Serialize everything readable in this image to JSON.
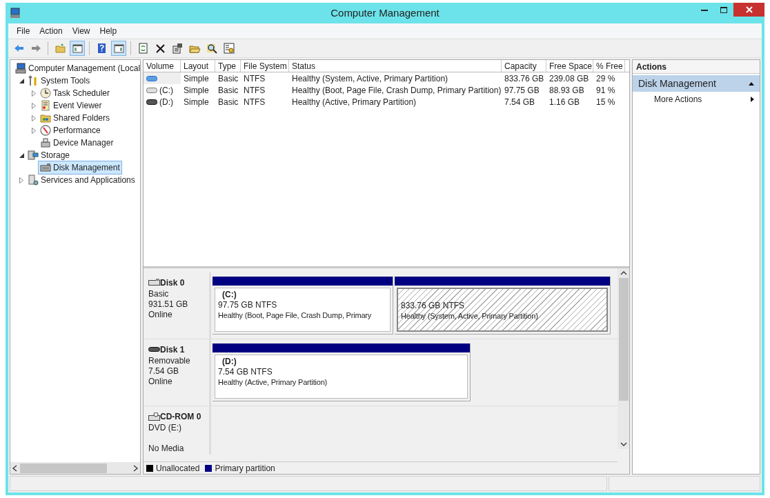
{
  "window": {
    "title": "Computer Management"
  },
  "menu": [
    "File",
    "Action",
    "View",
    "Help"
  ],
  "toolbar": [
    {
      "kind": "back",
      "selected": false
    },
    {
      "kind": "forward",
      "selected": false
    },
    {
      "kind": "sep"
    },
    {
      "kind": "folder-up",
      "selected": false
    },
    {
      "kind": "console-tree",
      "selected": true
    },
    {
      "kind": "sep"
    },
    {
      "kind": "help",
      "selected": false
    },
    {
      "kind": "action-pane",
      "selected": true
    },
    {
      "kind": "sep"
    },
    {
      "kind": "refresh",
      "selected": false
    },
    {
      "kind": "delete",
      "selected": false
    },
    {
      "kind": "properties",
      "selected": false
    },
    {
      "kind": "open",
      "selected": false
    },
    {
      "kind": "search",
      "selected": false
    },
    {
      "kind": "settings",
      "selected": false
    }
  ],
  "tree": [
    {
      "label": "Computer Management (Local",
      "kind": "computer",
      "selected": false,
      "children": [
        {
          "label": "System Tools",
          "kind": "tools",
          "expanded": true,
          "selected": false,
          "children": [
            {
              "label": "Task Scheduler",
              "kind": "clock",
              "expanded": false,
              "selected": false
            },
            {
              "label": "Event Viewer",
              "kind": "log",
              "expanded": false,
              "selected": false
            },
            {
              "label": "Shared Folders",
              "kind": "share",
              "expanded": false,
              "selected": false
            },
            {
              "label": "Performance",
              "kind": "gauge",
              "expanded": false,
              "selected": false
            },
            {
              "label": "Device Manager",
              "kind": "device",
              "selected": false
            }
          ]
        },
        {
          "label": "Storage",
          "kind": "storage",
          "expanded": true,
          "selected": false,
          "children": [
            {
              "label": "Disk Management",
              "kind": "disk",
              "selected": true
            }
          ]
        },
        {
          "label": "Services and Applications",
          "kind": "services",
          "expanded": false,
          "selected": false
        }
      ]
    }
  ],
  "table": {
    "columns": [
      "Volume",
      "Layout",
      "Type",
      "File System",
      "Status",
      "Capacity",
      "Free Space",
      "% Free"
    ],
    "rows": [
      {
        "kind": "blue",
        "cells": [
          "",
          "Simple",
          "Basic",
          "NTFS",
          "Healthy (System, Active, Primary Partition)",
          "833.76 GB",
          "239.08 GB",
          "29 %"
        ]
      },
      {
        "kind": "gray",
        "cells": [
          "(C:)",
          "Simple",
          "Basic",
          "NTFS",
          "Healthy (Boot, Page File, Crash Dump, Primary Partition)",
          "97.75 GB",
          "88.93 GB",
          "91 %"
        ]
      },
      {
        "kind": "dark",
        "cells": [
          "(D:)",
          "Simple",
          "Basic",
          "NTFS",
          "Healthy (Active, Primary Partition)",
          "7.54 GB",
          "1.16 GB",
          "15 %"
        ]
      }
    ]
  },
  "disks": [
    {
      "name": "Disk 0",
      "kind": "hdd",
      "info": [
        "Basic",
        "931.51 GB",
        "Online"
      ],
      "partitions": [
        {
          "name": "(C:)",
          "size": "97.75 GB NTFS",
          "status": "Healthy (Boot, Page File, Crash Dump, Primary",
          "selected": false
        },
        {
          "size": "833.76 GB NTFS",
          "status": "Healthy (System, Active, Primary Partition)",
          "selected": true
        }
      ]
    },
    {
      "name": "Disk 1",
      "kind": "removable",
      "info": [
        "Removable",
        "7.54 GB",
        "Online"
      ],
      "partitions": [
        {
          "name": "(D:)",
          "size": "7.54 GB NTFS",
          "status": "Healthy (Active, Primary Partition)",
          "selected": false
        }
      ]
    },
    {
      "name": "CD-ROM 0",
      "kind": "cdrom",
      "info": [
        "DVD (E:)",
        "No Media"
      ]
    }
  ],
  "legend": [
    {
      "label": "Unallocated",
      "color": "#000000"
    },
    {
      "label": "Primary partition",
      "color": "#000080"
    }
  ],
  "actions": {
    "title": "Actions",
    "section": "Disk Management",
    "items": [
      "More Actions"
    ]
  }
}
